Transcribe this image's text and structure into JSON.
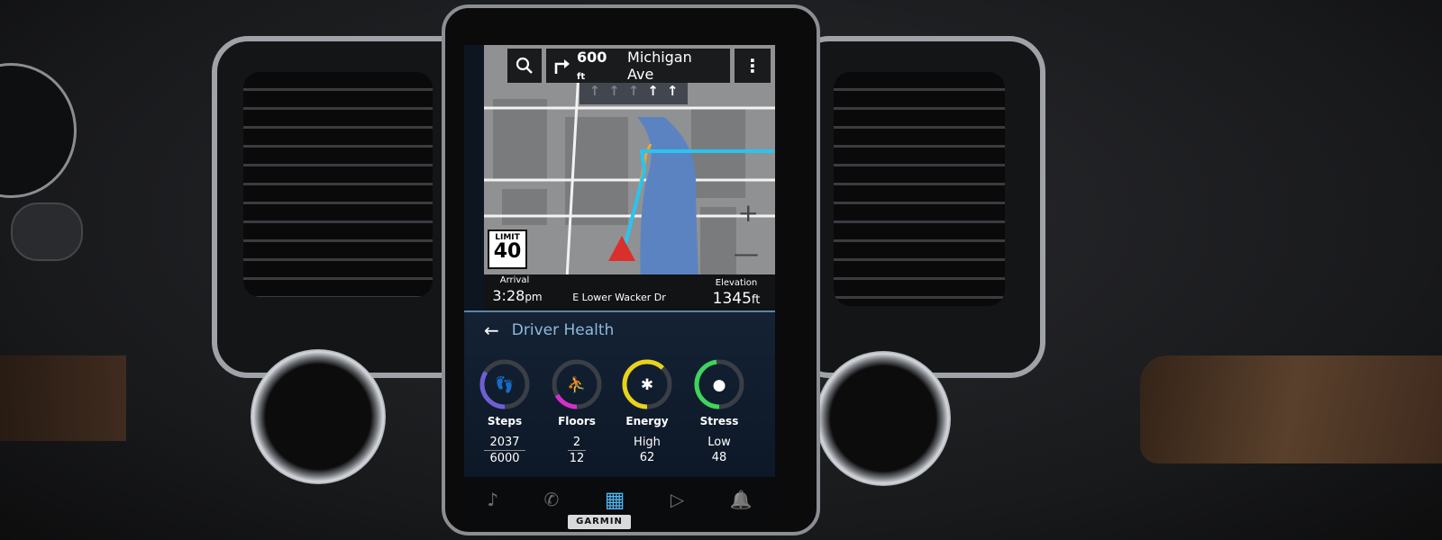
{
  "navigation": {
    "search_icon": "search-icon",
    "turn_icon": "turn-right-icon",
    "distance": "600",
    "distance_unit": "ft",
    "street": "Michigan Ave",
    "menu_icon": "more-vertical-icon",
    "lanes": [
      "↑",
      "↑",
      "↑",
      "↑",
      "↑"
    ],
    "speed_limit_label": "LIMIT",
    "speed_limit": "40",
    "zoom_in": "+",
    "zoom_out": "—",
    "arrival_label": "Arrival",
    "arrival_time": "3:28",
    "arrival_suffix": "pm",
    "current_road": "E Lower Wacker Dr",
    "elevation_label": "Elevation",
    "elevation_value": "1345",
    "elevation_unit": "ft"
  },
  "health": {
    "title": "Driver Health",
    "metrics": [
      {
        "label": "Steps",
        "value": "2037",
        "goal": "6000",
        "fill": 0.34,
        "color": "#6f5fd6",
        "icon": "footprints-icon"
      },
      {
        "label": "Floors",
        "value": "2",
        "goal": "12",
        "fill": 0.17,
        "color": "#d62fc8",
        "icon": "stairs-climb-icon"
      },
      {
        "label": "Energy",
        "level": "High",
        "value": "62",
        "fill": 0.62,
        "color": "#e8d21e",
        "icon": "body-energy-icon"
      },
      {
        "label": "Stress",
        "level": "Low",
        "value": "48",
        "fill": 0.48,
        "color": "#3fd45a",
        "icon": "stress-person-icon"
      }
    ]
  },
  "bottom_nav": [
    {
      "icon": "music-icon",
      "glyph": "♪"
    },
    {
      "icon": "phone-icon",
      "glyph": "✆"
    },
    {
      "icon": "apps-grid-icon",
      "glyph": "▦",
      "active": true
    },
    {
      "icon": "media-play-icon",
      "glyph": "▷"
    },
    {
      "icon": "notification-bell-icon",
      "glyph": "🔔"
    }
  ],
  "brand": "GARMIN",
  "colors": {
    "accent": "#8fb9da",
    "route": "#29c4ef",
    "river": "#5b83c2",
    "active_nav": "#4fb7f0"
  }
}
